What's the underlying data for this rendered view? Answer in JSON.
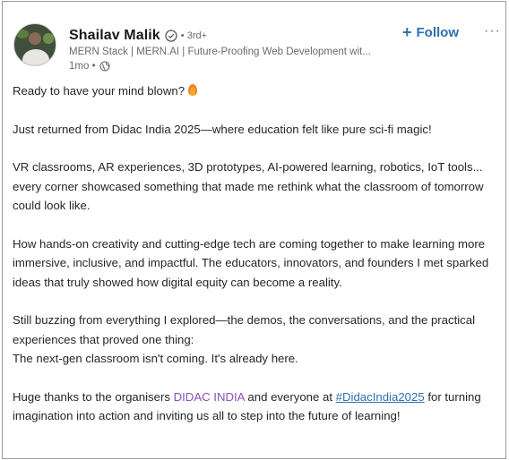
{
  "post": {
    "author": {
      "name": "Shailav Malik",
      "degree": "• 3rd+",
      "headline": "MERN Stack | MERN.AI | Future-Proofing Web Development wit...",
      "time": "1mo •"
    },
    "follow_label": "Follow",
    "follow_plus": "+",
    "more_label": "···",
    "paragraphs": {
      "p1": "Ready to have your mind blown?",
      "p2": "Just returned from Didac India 2025—where education felt like pure sci-fi magic!",
      "p3": "VR classrooms, AR experiences, 3D prototypes, AI-powered learning, robotics, IoT tools... every corner showcased something that made me rethink what the classroom of tomorrow could look like.",
      "p4": "How hands-on creativity and cutting-edge tech are coming together to make learning more immersive, inclusive, and impactful. The educators, innovators, and founders I met sparked ideas that truly showed how digital equity can become a reality.",
      "p5a": "Still buzzing from everything I explored—the demos, the conversations, and the practical experiences that proved one thing:",
      "p5b": "The next-gen classroom isn't coming. It's already here.",
      "p6_before": "Huge thanks to the organisers ",
      "p6_mention": "DIDAC INDIA",
      "p6_middle": " and everyone at ",
      "p6_hashtag": "#DidacIndia2025",
      "p6_after": " for turning imagination into action and inviting us all to step into the future of learning!"
    },
    "colors": {
      "follow": "#2f6fb0",
      "mention": "#8b4fb3",
      "hashtag": "#2f6fb0",
      "border": "#9c9c9c"
    },
    "icons": {
      "verified": "shield-check-icon",
      "globe": "globe-icon",
      "fire": "fire-emoji-icon",
      "more": "more-horizontal-icon"
    }
  }
}
